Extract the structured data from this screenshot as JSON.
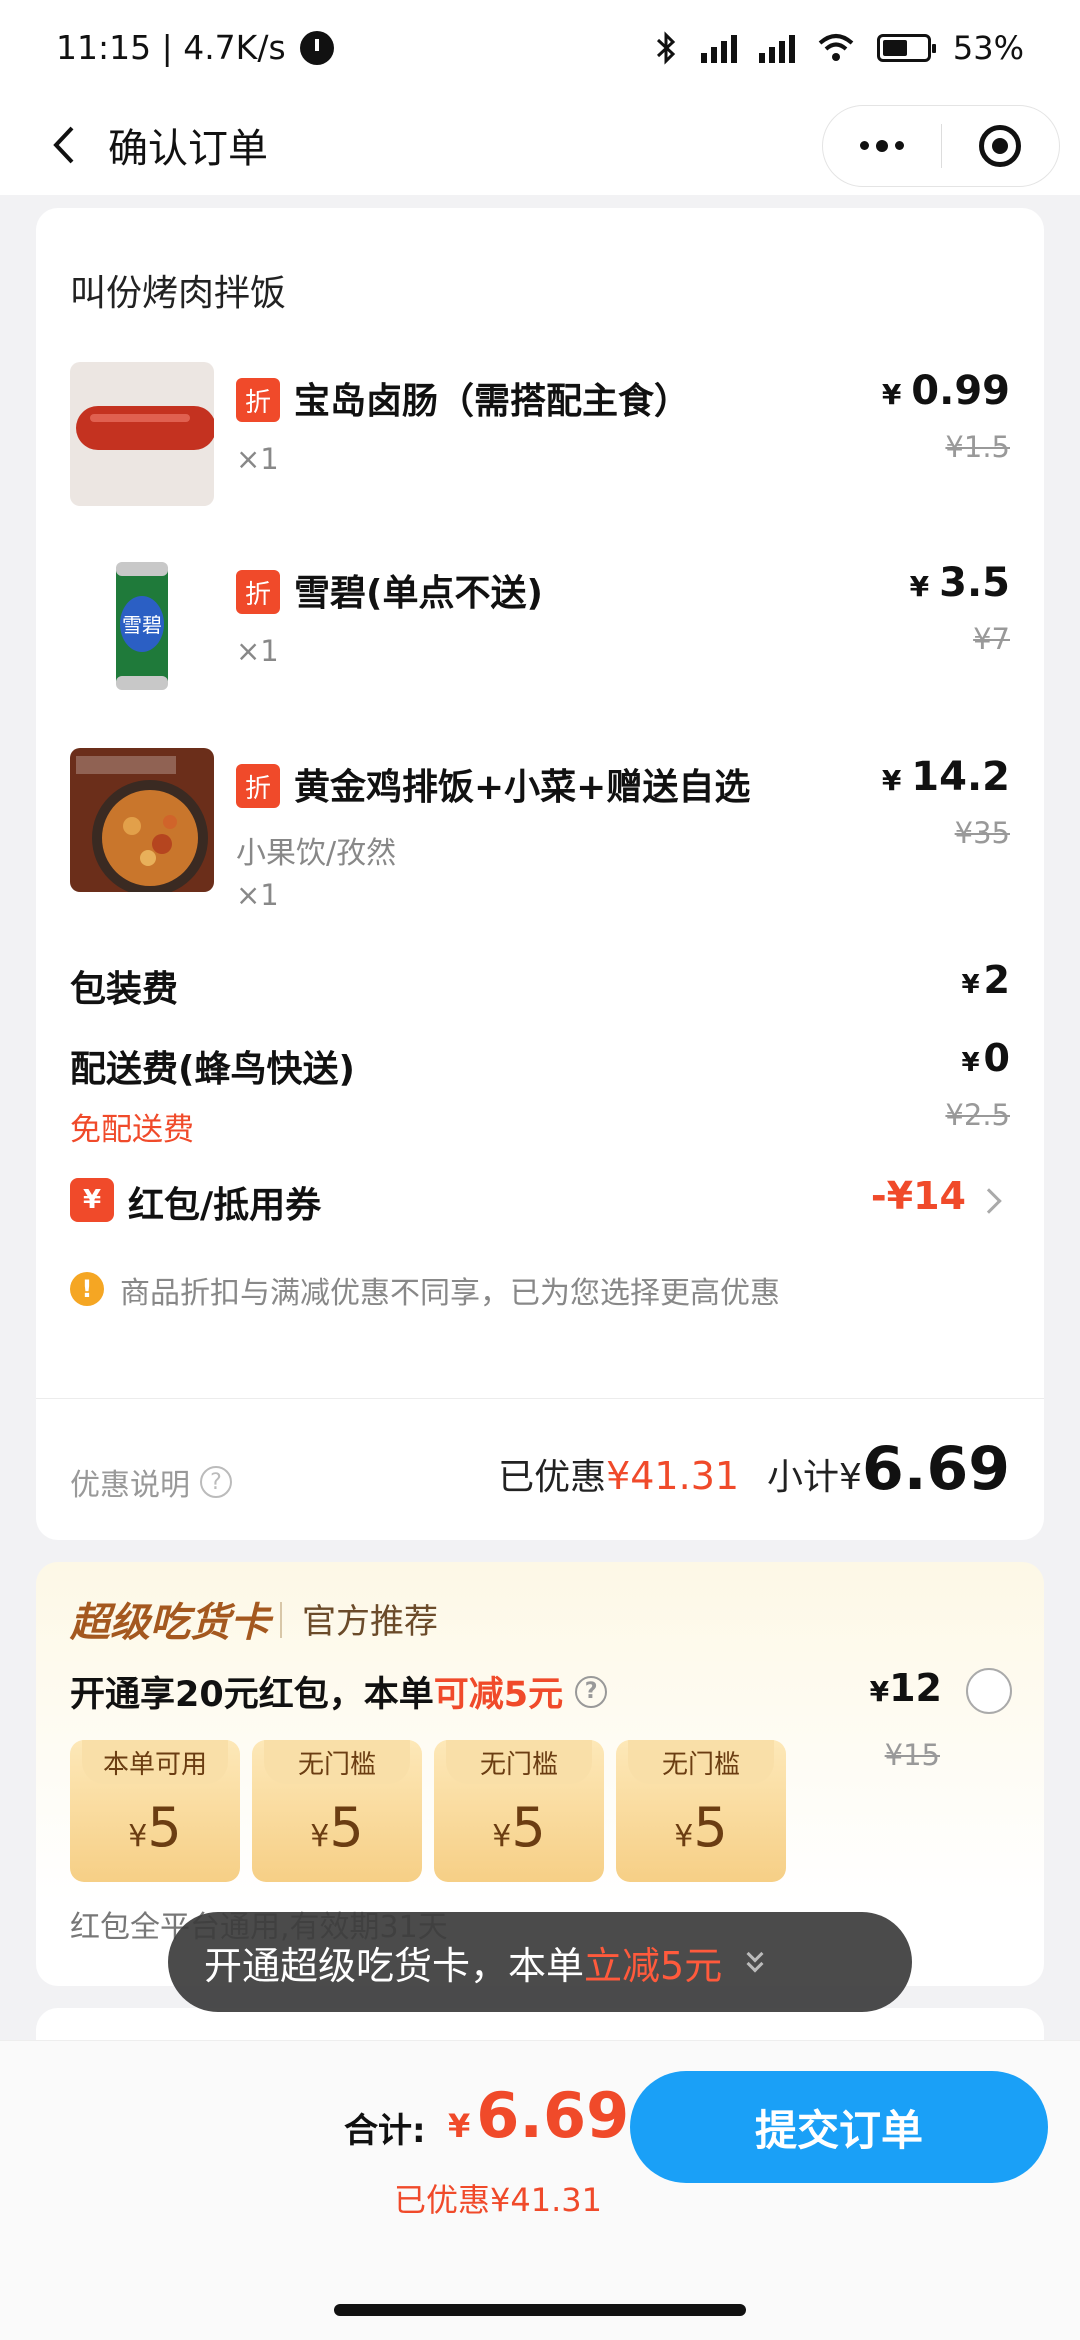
{
  "status": {
    "time_speed": "11:15 | 4.7K/s",
    "battery_pct": "53%"
  },
  "nav": {
    "title": "确认订单"
  },
  "order": {
    "shop_name": "叫份烤肉拌饭",
    "discount_tag": "折",
    "items": [
      {
        "name": "宝岛卤肠（需搭配主食）",
        "qty": "×1",
        "price": "0.99",
        "orig": "¥1.5",
        "spec": ""
      },
      {
        "name": "雪碧(单点不送)",
        "qty": "×1",
        "price": "3.5",
        "orig": "¥7",
        "spec": ""
      },
      {
        "name": "黄金鸡排饭+小菜+赠送自选",
        "qty": "×1",
        "price": "14.2",
        "orig": "¥35",
        "spec": "小果饮/孜然"
      }
    ],
    "yen": "¥",
    "packing_label": "包装费",
    "packing_value": "2",
    "delivery_label": "配送费(蜂鸟快送)",
    "delivery_value": "0",
    "delivery_orig": "¥2.5",
    "free_delivery": "免配送费",
    "coupon_label": "红包/抵用券",
    "coupon_value": "-¥14",
    "coupon_icon": "¥",
    "tip": "商品折扣与满减优惠不同享，已为您选择更高优惠",
    "discount_desc": "优惠说明",
    "saved_label": "已优惠",
    "saved_value": "¥41.31",
    "subtotal_label": "小计¥",
    "subtotal_value": "6.69"
  },
  "super_card": {
    "title": "超级吃货卡",
    "subtitle": "官方推荐",
    "line_prefix": "开通享20元红包，本单",
    "line_red": "可减5元",
    "price": "12",
    "orig": "¥15",
    "vouchers": [
      {
        "tag": "本单可用",
        "amount": "5"
      },
      {
        "tag": "无门槛",
        "amount": "5"
      },
      {
        "tag": "无门槛",
        "amount": "5"
      },
      {
        "tag": "无门槛",
        "amount": "5"
      }
    ],
    "note": "红包全平台通用,有效期31天"
  },
  "toast": {
    "prefix": "开通超级吃货卡，本单",
    "red": "立减5元"
  },
  "bottom": {
    "total_label": "合计:",
    "total_value": "6.69",
    "saved": "已优惠¥41.31",
    "submit": "提交订单"
  },
  "colors": {
    "accent_red": "#f04a2a",
    "submit_blue": "#1aa0f7",
    "gold": "#a4581f"
  }
}
